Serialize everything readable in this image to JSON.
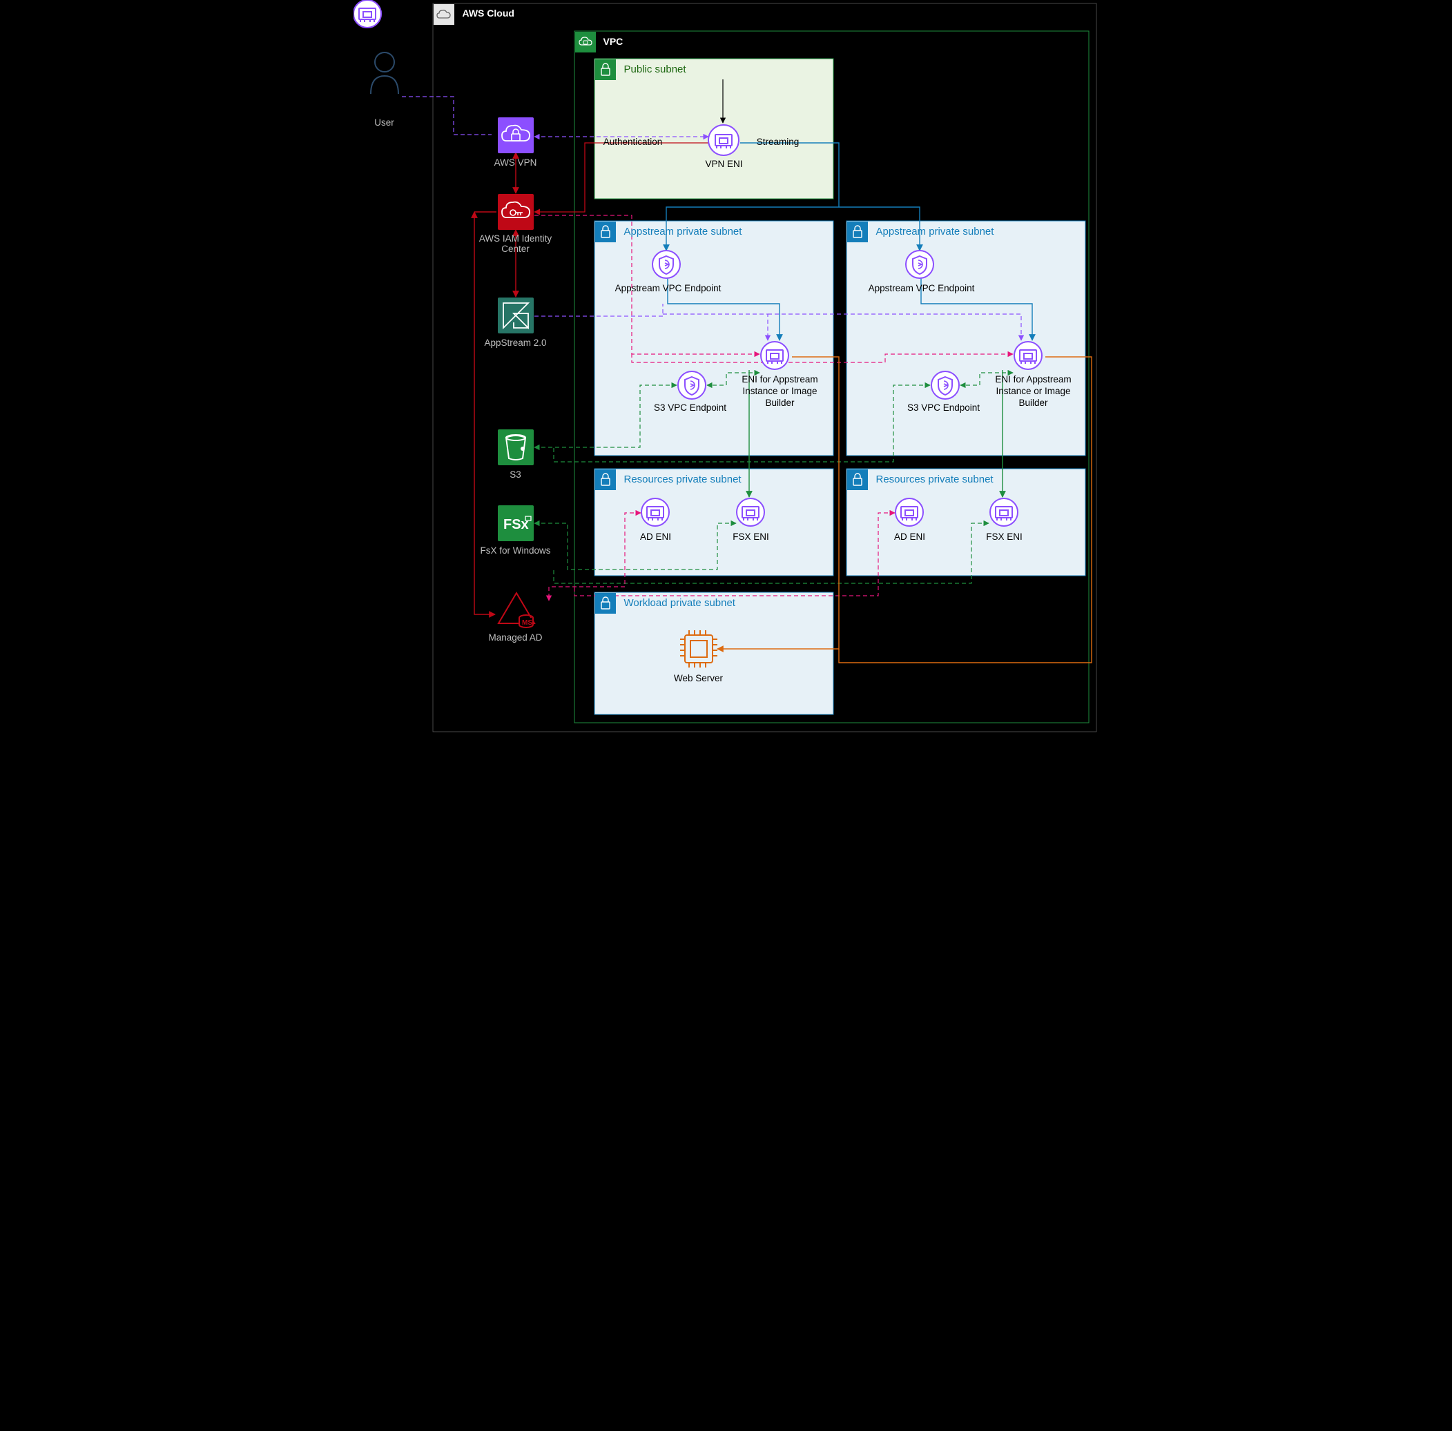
{
  "actor": {
    "user": "User"
  },
  "cloud": {
    "title": "AWS Cloud"
  },
  "vpc": {
    "title": "VPC"
  },
  "public_subnet": {
    "title": "Public subnet",
    "vpn_eni": "VPN ENI",
    "auth": "Authentication",
    "stream": "Streaming"
  },
  "appstream_subnet": {
    "title": "Appstream private subnet",
    "vpc_ep": "Appstream VPC Endpoint",
    "s3_ep": "S3 VPC Endpoint",
    "eni": "ENI for Appstream Instance or Image Builder"
  },
  "resources_subnet": {
    "title": "Resources private subnet",
    "ad_eni": "AD ENI",
    "fsx_eni": "FSX ENI"
  },
  "workload_subnet": {
    "title": "Workload private subnet",
    "webserver": "Web Server"
  },
  "services": {
    "vpn": "AWS VPN",
    "iam": "AWS IAM Identity Center",
    "appstream": "AppStream 2.0",
    "s3": "S3",
    "fsx": "FsX for Windows",
    "managed_ad": "Managed AD"
  },
  "colors": {
    "green": "#1e8e3e",
    "green_fill": "#eaf3e3",
    "blue": "#147eba",
    "blue_fill": "#e7f1f7",
    "purple": "#8c4fff",
    "red": "#e7157b",
    "brick": "#bf0816",
    "orange": "#dd6b10",
    "teal": "#277566"
  }
}
